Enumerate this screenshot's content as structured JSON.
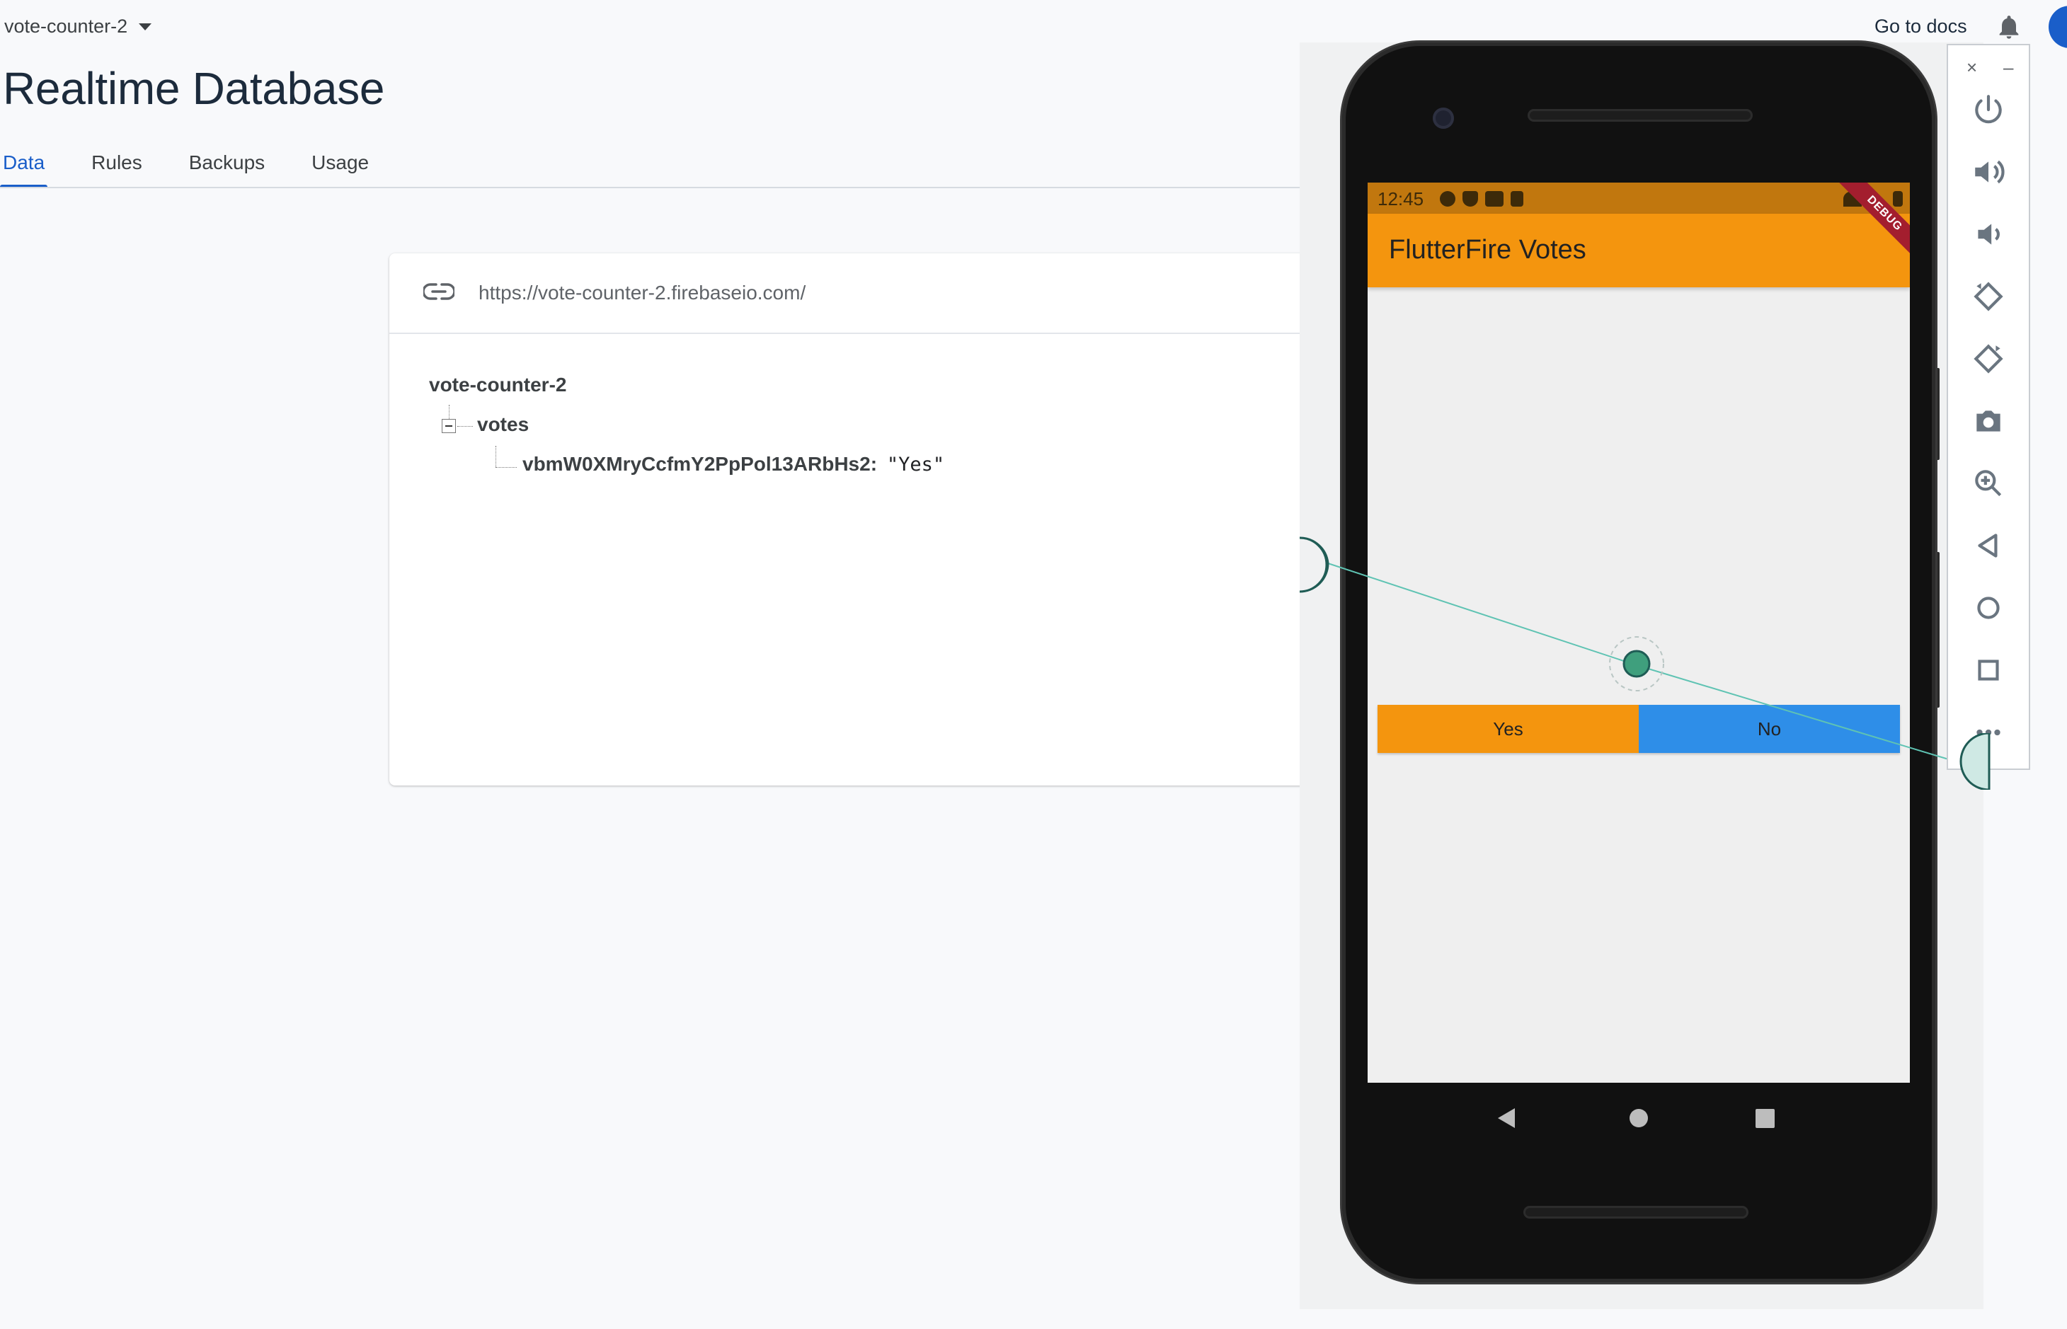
{
  "header": {
    "project_name": "vote-counter-2",
    "page_title": "Realtime Database",
    "docs_link": "Go to docs"
  },
  "tabs": [
    {
      "label": "Data"
    },
    {
      "label": "Rules"
    },
    {
      "label": "Backups"
    },
    {
      "label": "Usage"
    }
  ],
  "database": {
    "url": "https://vote-counter-2.firebaseio.com/",
    "root": "vote-counter-2",
    "child": "votes",
    "entry_key": "vbmW0XMryCcfmY2PpPol13ARbHs2:",
    "entry_value": "\"Yes\""
  },
  "phone": {
    "status_time": "12:45",
    "app_title": "FlutterFire Votes",
    "debug_banner": "DEBUG",
    "yes_label": "Yes",
    "no_label": "No"
  },
  "emulator_toolbar": {
    "close": "×",
    "minimize": "–",
    "icons": [
      "power-icon",
      "volume-up-icon",
      "volume-down-icon",
      "rotate-left-icon",
      "rotate-right-icon",
      "camera-icon",
      "zoom-in-icon",
      "back-icon",
      "home-icon",
      "overview-icon",
      "more-icon"
    ]
  },
  "colors": {
    "accent_blue": "#1a5ec9",
    "app_bar_orange": "#f4950e",
    "no_button_blue": "#2e8ee8"
  }
}
